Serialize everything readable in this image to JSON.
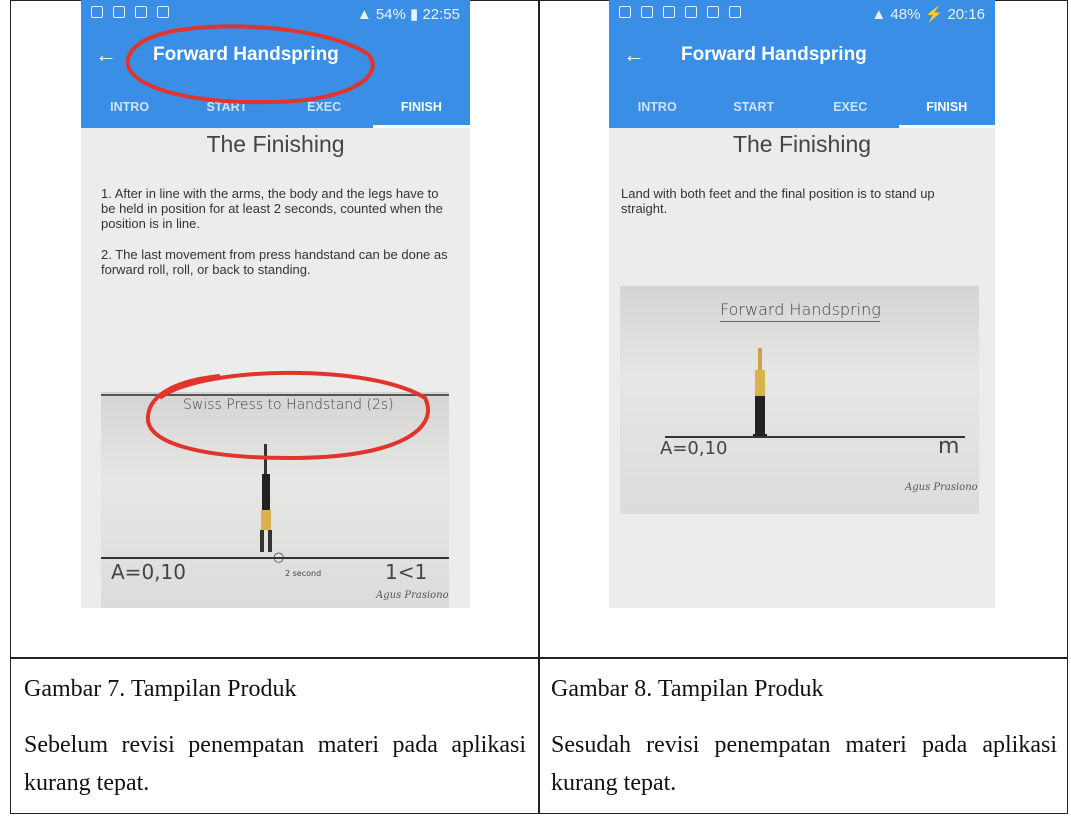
{
  "left_phone": {
    "status_time": "22:55",
    "status_battery": "54%",
    "app_title": "Forward Handspring",
    "tabs": [
      "INTRO",
      "START",
      "EXEC",
      "FINISH"
    ],
    "heading": "The Finishing",
    "paragraph1": "1. After in line with the arms, the body and the legs have to be held in position for at least 2 seconds, counted when the position is in line.",
    "paragraph2": "2. The last movement from press handstand can be done as forward roll, roll, or back to standing.",
    "sketch_title": "Swiss Press to Handstand (2s)",
    "score": "A=0,10",
    "timer_label": "2 second",
    "symbol": "1<1",
    "signature": "Agus Prasiono"
  },
  "right_phone": {
    "status_time": "20:16",
    "status_battery": "48%",
    "app_title": "Forward Handspring",
    "tabs": [
      "INTRO",
      "START",
      "EXEC",
      "FINISH"
    ],
    "heading": "The Finishing",
    "paragraph1": "Land with both feet and the final position is to stand up straight.",
    "sketch_title": "Forward Handspring",
    "score": "A=0,10",
    "symbol": "m",
    "signature": "Agus Prasiono"
  },
  "captions": {
    "left_title": "Gambar 7. Tampilan Produk",
    "left_desc": "Sebelum revisi penempatan materi pada aplikasi kurang tepat.",
    "right_title": "Gambar 8. Tampilan Produk",
    "right_desc": "Sesudah revisi penempatan materi pada aplikasi kurang tepat."
  },
  "colors": {
    "appbar": "#3a8ee6",
    "annotation": "#e0342c"
  }
}
